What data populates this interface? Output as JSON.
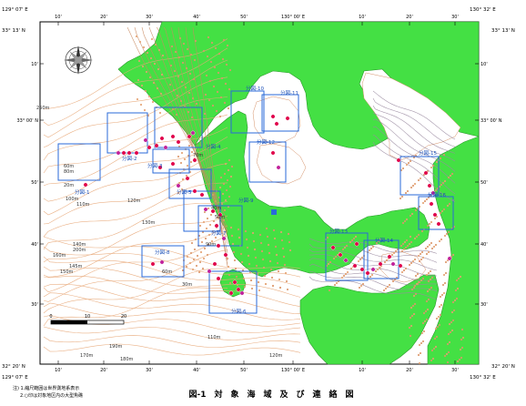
{
  "corner_coords": {
    "top_left_lon": "129° 07' E",
    "top_right_lon": "130° 32' E",
    "bottom_left_lon": "129° 07' E",
    "bottom_right_lon": "130° 32' E",
    "top_left_lat": "33° 13' N",
    "top_right_lat": "33° 13' N",
    "bottom_left_lat": "32° 20' N",
    "bottom_right_lat": "32° 20' N"
  },
  "lon_ticks_top": [
    "10'",
    "20'",
    "30'",
    "40'",
    "50'",
    "130° 00' E",
    "10'",
    "20'",
    "30'"
  ],
  "lon_ticks_bottom": [
    "10'",
    "20'",
    "30'",
    "40'",
    "50'",
    "130° 00' E",
    "10'",
    "20'",
    "30'"
  ],
  "lat_ticks_left": [
    "10'",
    "33° 00' N",
    "50'",
    "40'",
    "30'"
  ],
  "lat_ticks_right": [
    "10'",
    "33° 00' N",
    "50'",
    "40'",
    "30'"
  ],
  "area_labels": [
    "分図-1",
    "分図-2",
    "分図-3",
    "分図-4",
    "分図-5",
    "分図-6",
    "分図-7",
    "分図-8",
    "分図-9",
    "分図-10",
    "分図-11",
    "分図-12",
    "分図-13",
    "分図-14",
    "分図-15",
    "分図-16"
  ],
  "depth_labels": [
    "20m",
    "60m",
    "80m",
    "100m",
    "110m",
    "120m",
    "130m",
    "140m",
    "145m",
    "150m",
    "160m",
    "170m",
    "180m",
    "190m",
    "200m",
    "250m",
    "60m",
    "30m",
    "40m",
    "50m",
    "70m",
    "90m",
    "110m",
    "120m"
  ],
  "scale_bar": {
    "labels": [
      "0",
      "10",
      "20"
    ],
    "unit": "km"
  },
  "figure_title": "図-1　対　象　海　域　及　び　連　絡　図",
  "notes": [
    "注) 1.縮尺範囲は世界測地系表示",
    "2.○印は対象地区内の大型魚礁"
  ],
  "colors": {
    "land": "#44e044",
    "sea": "#ffffff",
    "contour": "#e8a878",
    "contour_inner": "#b07050",
    "box": "#2a6ad8",
    "label_text": "#1a4fb8",
    "reef_dot": "#e0004a",
    "reef_dot_alt": "#c0209a",
    "frame": "#000000"
  },
  "compass_icon": "compass-rose-icon"
}
